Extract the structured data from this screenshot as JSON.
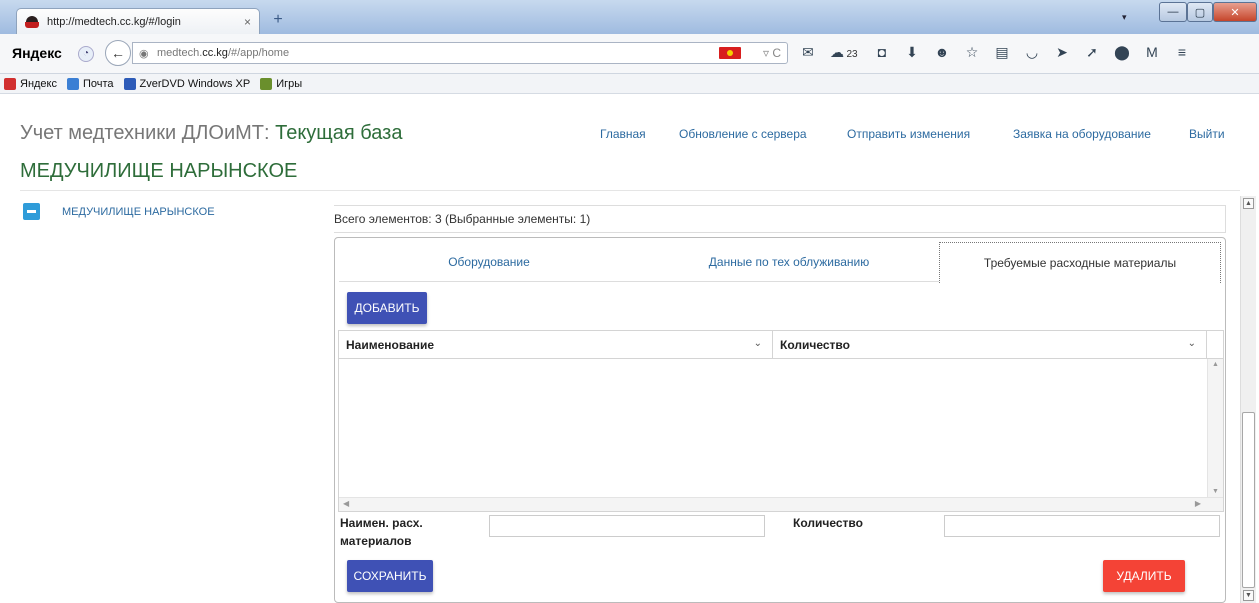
{
  "browser": {
    "tab_title": "http://medtech.cc.kg/#/login",
    "tab_close": "×",
    "new_tab": "+",
    "window": {
      "min": "—",
      "max": "▢",
      "close": "✕"
    },
    "tab_list": "▾",
    "yandex": "Яндекс",
    "back": "←",
    "url_prefix": "medtech.",
    "url_host": "cc.kg",
    "url_path": "/#/app/home",
    "reload": "▿ C",
    "weather": "23",
    "bookmarks": [
      {
        "label": "Яндекс",
        "color": "#d12f2f"
      },
      {
        "label": "Почта",
        "color": "#3b7fd4"
      },
      {
        "label": "ZverDVD Windows XP",
        "color": "#2d5bb8"
      },
      {
        "label": "Игры",
        "color": "#6a8f2c"
      }
    ]
  },
  "header": {
    "title_prefix": "Учет медтехники ДЛОиМТ: ",
    "title_db": "Текущая база",
    "subtitle": "МЕДУЧИЛИЩЕ НАРЫНСКОЕ",
    "nav": [
      "Главная",
      "Обновление с сервера",
      "Отправить изменения",
      "Заявка на оборудование",
      "Выйти"
    ]
  },
  "sidebar": {
    "tree_item": "МЕДУЧИЛИЩЕ НАРЫНСКОЕ"
  },
  "main": {
    "count_line": "Всего элементов: 3 (Выбранные элементы: 1)",
    "tabs": [
      "Оборудование",
      "Данные по тех облуживанию",
      "Требуемые расходные материалы"
    ],
    "active_tab": 2,
    "add_button": "ДОБАВИТЬ",
    "grid": {
      "columns": [
        "Наименование",
        "Количество"
      ],
      "rows": []
    },
    "form": {
      "name_label": "Наимен. расх. материалов",
      "name_value": "",
      "qty_label": "Количество",
      "qty_value": ""
    },
    "save_button": "СОХРАНИТЬ",
    "delete_button": "УДАЛИТЬ"
  },
  "colors": {
    "accent_blue": "#3f51b5",
    "danger_red": "#f44336",
    "link": "#2c6aa0",
    "db_green": "#2e6d3a"
  }
}
